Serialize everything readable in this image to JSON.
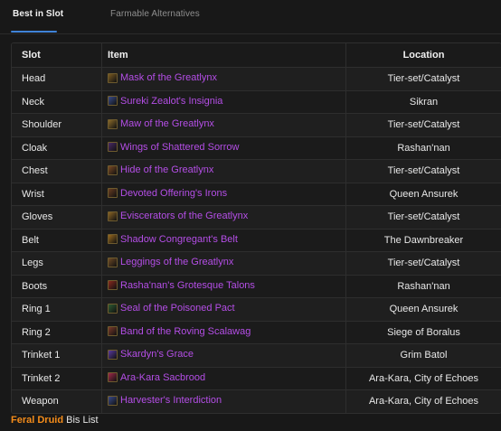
{
  "tabs": {
    "active": "Best in Slot",
    "inactive": "Farmable Alternatives"
  },
  "table": {
    "headers": {
      "slot": "Slot",
      "item": "Item",
      "location": "Location"
    },
    "rows": [
      {
        "slot": "Head",
        "item": "Mask of the Greatlynx",
        "location": "Tier-set/Catalyst",
        "icon": "helm-icon",
        "color": "#7a5a22"
      },
      {
        "slot": "Neck",
        "item": "Sureki Zealot's Insignia",
        "location": "Sikran",
        "icon": "amulet-icon",
        "color": "#3a4c8a"
      },
      {
        "slot": "Shoulder",
        "item": "Maw of the Greatlynx",
        "location": "Tier-set/Catalyst",
        "icon": "shoulder-icon",
        "color": "#8a6a2a"
      },
      {
        "slot": "Cloak",
        "item": "Wings of Shattered Sorrow",
        "location": "Rashan'nan",
        "icon": "cloak-icon",
        "color": "#4a2a66"
      },
      {
        "slot": "Chest",
        "item": "Hide of the Greatlynx",
        "location": "Tier-set/Catalyst",
        "icon": "chest-icon",
        "color": "#7a4a24"
      },
      {
        "slot": "Wrist",
        "item": "Devoted Offering's Irons",
        "location": "Queen Ansurek",
        "icon": "bracer-icon",
        "color": "#6a3e22"
      },
      {
        "slot": "Gloves",
        "item": "Eviscerators of the Greatlynx",
        "location": "Tier-set/Catalyst",
        "icon": "gloves-icon",
        "color": "#8a6424"
      },
      {
        "slot": "Belt",
        "item": "Shadow Congregant's Belt",
        "location": "The Dawnbreaker",
        "icon": "belt-icon",
        "color": "#9a6a1e"
      },
      {
        "slot": "Legs",
        "item": "Leggings of the Greatlynx",
        "location": "Tier-set/Catalyst",
        "icon": "legs-icon",
        "color": "#6e4a26"
      },
      {
        "slot": "Boots",
        "item": "Rasha'nan's Grotesque Talons",
        "location": "Rashan'nan",
        "icon": "boots-icon",
        "color": "#8a2a1e"
      },
      {
        "slot": "Ring 1",
        "item": "Seal of the Poisoned Pact",
        "location": "Queen Ansurek",
        "icon": "ring-icon",
        "color": "#2e5a32"
      },
      {
        "slot": "Ring 2",
        "item": "Band of the Roving Scalawag",
        "location": "Siege of Boralus",
        "icon": "ring-icon",
        "color": "#7a3a2a"
      },
      {
        "slot": "Trinket 1",
        "item": "Skardyn's Grace",
        "location": "Grim Batol",
        "icon": "trinket-icon",
        "color": "#5a3aa0"
      },
      {
        "slot": "Trinket 2",
        "item": "Ara-Kara Sacbrood",
        "location": "Ara-Kara, City of Echoes",
        "icon": "trinket-icon",
        "color": "#a02a4a"
      },
      {
        "slot": "Weapon",
        "item": "Harvester's Interdiction",
        "location": "Ara-Kara, City of Echoes",
        "icon": "staff-icon",
        "color": "#3a4a8a"
      }
    ]
  },
  "footer": {
    "class_name": "Feral Druid",
    "suffix": " Bis List"
  },
  "colors": {
    "item_link": "#b44ee6",
    "class_color": "#f48c1a",
    "tab_accent": "#3f83d8"
  }
}
